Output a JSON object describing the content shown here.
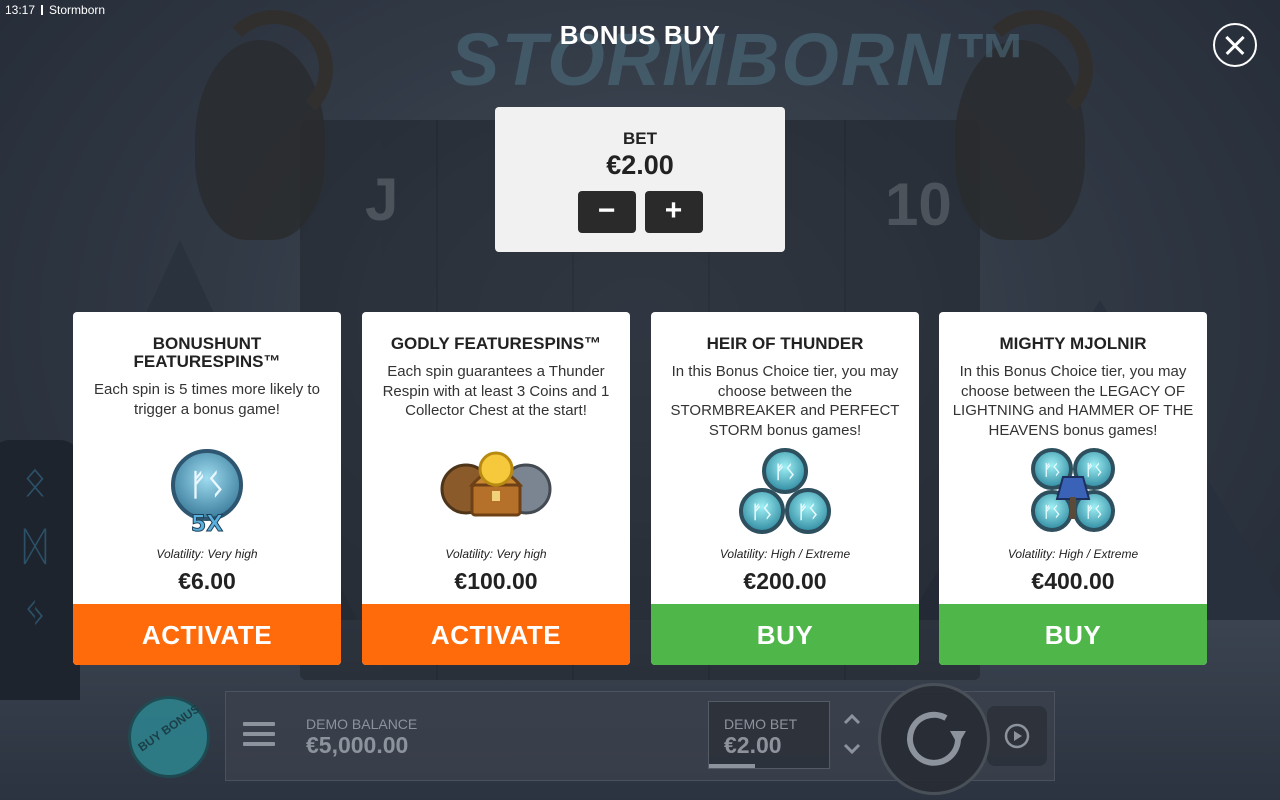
{
  "status_bar": {
    "time": "13:17",
    "app_name": "Stormborn"
  },
  "game": {
    "logo_text": "STORMBORN™"
  },
  "modal": {
    "title": "BONUS BUY",
    "close_icon": "close-icon"
  },
  "bet": {
    "label": "BET",
    "value": "€2.00",
    "minus": "−",
    "plus": "+"
  },
  "cards": [
    {
      "title": "BONUSHUNT FEATURESPINS™",
      "description": "Each spin is 5 times more likely to trigger a bonus game!",
      "icon": "rune-5x-icon",
      "volatility": "Volatility: Very high",
      "price": "€6.00",
      "action": "ACTIVATE",
      "action_color": "#ff6a0b"
    },
    {
      "title": "GODLY FEATURESPINS™",
      "description": "Each spin guarantees a Thunder Respin with at least 3 Coins and 1 Collector Chest at the start!",
      "icon": "treasure-chest-icon",
      "volatility": "Volatility: Very high",
      "price": "€100.00",
      "action": "ACTIVATE",
      "action_color": "#ff6a0b"
    },
    {
      "title": "HEIR OF THUNDER",
      "description": "In this Bonus Choice tier, you may choose between the STORMBREAKER and PERFECT STORM bonus games!",
      "icon": "three-rune-coins-icon",
      "volatility": "Volatility: High / Extreme",
      "price": "€200.00",
      "action": "BUY",
      "action_color": "#4fb64a"
    },
    {
      "title": "MIGHTY MJOLNIR",
      "description": "In this Bonus Choice tier, you may choose between the LEGACY OF LIGHTNING and HAMMER OF THE HEAVENS bonus games!",
      "icon": "four-rune-coins-hammer-icon",
      "volatility": "Volatility: High / Extreme",
      "price": "€400.00",
      "action": "BUY",
      "action_color": "#4fb64a"
    }
  ],
  "bottom_bar": {
    "buy_bonus": "BUY BONUS",
    "balance_label": "DEMO BALANCE",
    "balance_value": "€5,000.00",
    "bet_label": "DEMO BET",
    "bet_value": "€2.00"
  },
  "background_symbols": [
    "J",
    "10"
  ]
}
